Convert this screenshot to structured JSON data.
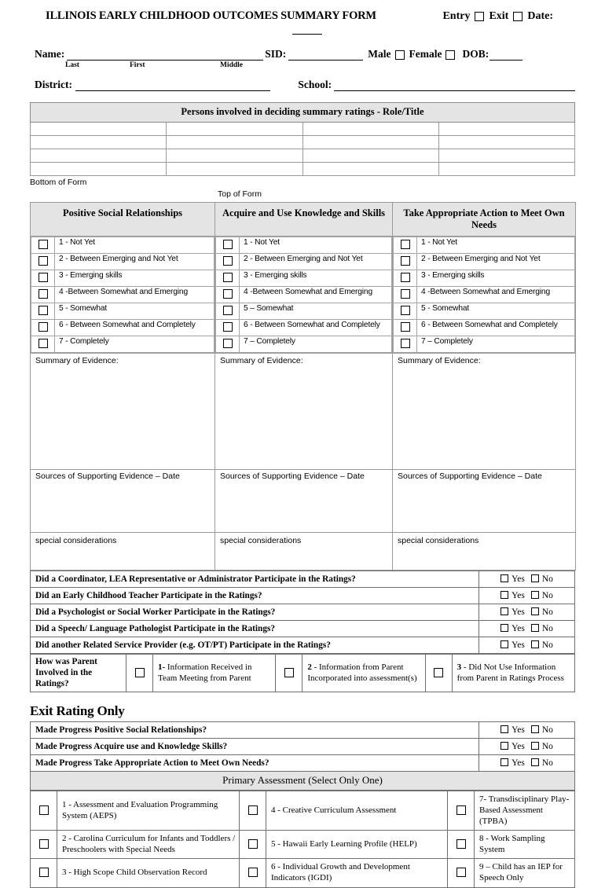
{
  "header": {
    "title": "ILLINOIS EARLY CHILDHOOD OUTCOMES SUMMARY FORM",
    "entry_label": "Entry",
    "exit_label": "Exit",
    "date_label": "Date:"
  },
  "identity": {
    "name_label": "Name:",
    "sub_last": "Last",
    "sub_first": "First",
    "sub_middle": "Middle",
    "sid_label": "SID:",
    "male_label": "Male",
    "female_label": "Female",
    "dob_label": "DOB:",
    "district_label": "District:",
    "school_label": "School:"
  },
  "persons": {
    "header": "Persons involved in deciding summary ratings - Role/Title",
    "row_count": 4,
    "col_count": 4
  },
  "form_marks": {
    "bottom": "Bottom of Form",
    "top": "Top of Form"
  },
  "outcomes": {
    "columns": [
      {
        "title": "Positive Social Relationships",
        "ratings": [
          "1 - Not Yet",
          "2 - Between Emerging and Not Yet",
          "3 - Emerging skills",
          "4 -Between Somewhat and Emerging",
          "5 - Somewhat",
          "6 - Between Somewhat and Completely",
          "7 - Completely"
        ],
        "summary_label": "Summary of Evidence:",
        "sources_label": "Sources of Supporting Evidence –   Date",
        "special_label": "special considerations"
      },
      {
        "title": "Acquire and Use Knowledge and Skills",
        "ratings": [
          "1 - Not Yet",
          "2 - Between Emerging and Not Yet",
          "3 - Emerging skills",
          "4 -Between Somewhat and Emerging",
          "5 – Somewhat",
          "6 - Between Somewhat and Completely",
          "7 – Completely"
        ],
        "summary_label": "Summary of Evidence:",
        "sources_label": "Sources of Supporting Evidence –   Date",
        "special_label": "special considerations"
      },
      {
        "title": "Take Appropriate Action to Meet Own Needs",
        "ratings": [
          "1 - Not Yet",
          "2 - Between Emerging and Not Yet",
          "3 - Emerging skills",
          "4 -Between Somewhat and Emerging",
          "5 - Somewhat",
          "6 - Between Somewhat and Completely",
          "7 – Completely"
        ],
        "summary_label": "Summary of Evidence:",
        "sources_label": "Sources of Supporting Evidence –   Date",
        "special_label": "special considerations"
      }
    ]
  },
  "participation": {
    "yes_label": "Yes",
    "no_label": "No",
    "questions": [
      "Did a Coordinator, LEA Representative or Administrator Participate in the Ratings?",
      "Did an Early Childhood Teacher Participate in the Ratings?",
      "Did a Psychologist or Social Worker Participate in the Ratings?",
      "Did a Speech/ Language Pathologist Participate in the Ratings?",
      "Did another Related Service Provider (e.g. OT/PT) Participate in the Ratings?"
    ]
  },
  "parent_involvement": {
    "question": "How was Parent Involved in the Ratings?",
    "options": [
      {
        "num": "1-",
        "text": "Information Received in Team Meeting from Parent"
      },
      {
        "num": "2",
        "text": "- Information from Parent Incorporated into assessment(s)"
      },
      {
        "num": "3",
        "text": "- Did Not Use Information from Parent in Ratings Process"
      }
    ]
  },
  "exit_rating": {
    "title": "Exit Rating Only",
    "yes_label": "Yes",
    "no_label": "No",
    "questions": [
      "Made Progress Positive Social Relationships?",
      "Made Progress Acquire use and Knowledge Skills?",
      "Made Progress Take Appropriate Action to Meet Own Needs?"
    ]
  },
  "primary_assessment": {
    "header": "Primary Assessment (Select Only One)",
    "items": [
      "1 - Assessment and Evaluation Programming System (AEPS)",
      "2 - Carolina Curriculum for Infants and Toddlers / Preschoolers with Special Needs",
      "3 - High Scope Child Observation Record",
      "4 - Creative Curriculum Assessment",
      "5 - Hawaii Early Learning Profile (HELP)",
      "6 - Individual Growth and Development Indicators (IGDI)",
      "7- Transdisciplinary Play-Based Assessment (TPBA)",
      "8 - Work Sampling System",
      "9 – Child has an IEP for Speech Only"
    ]
  }
}
